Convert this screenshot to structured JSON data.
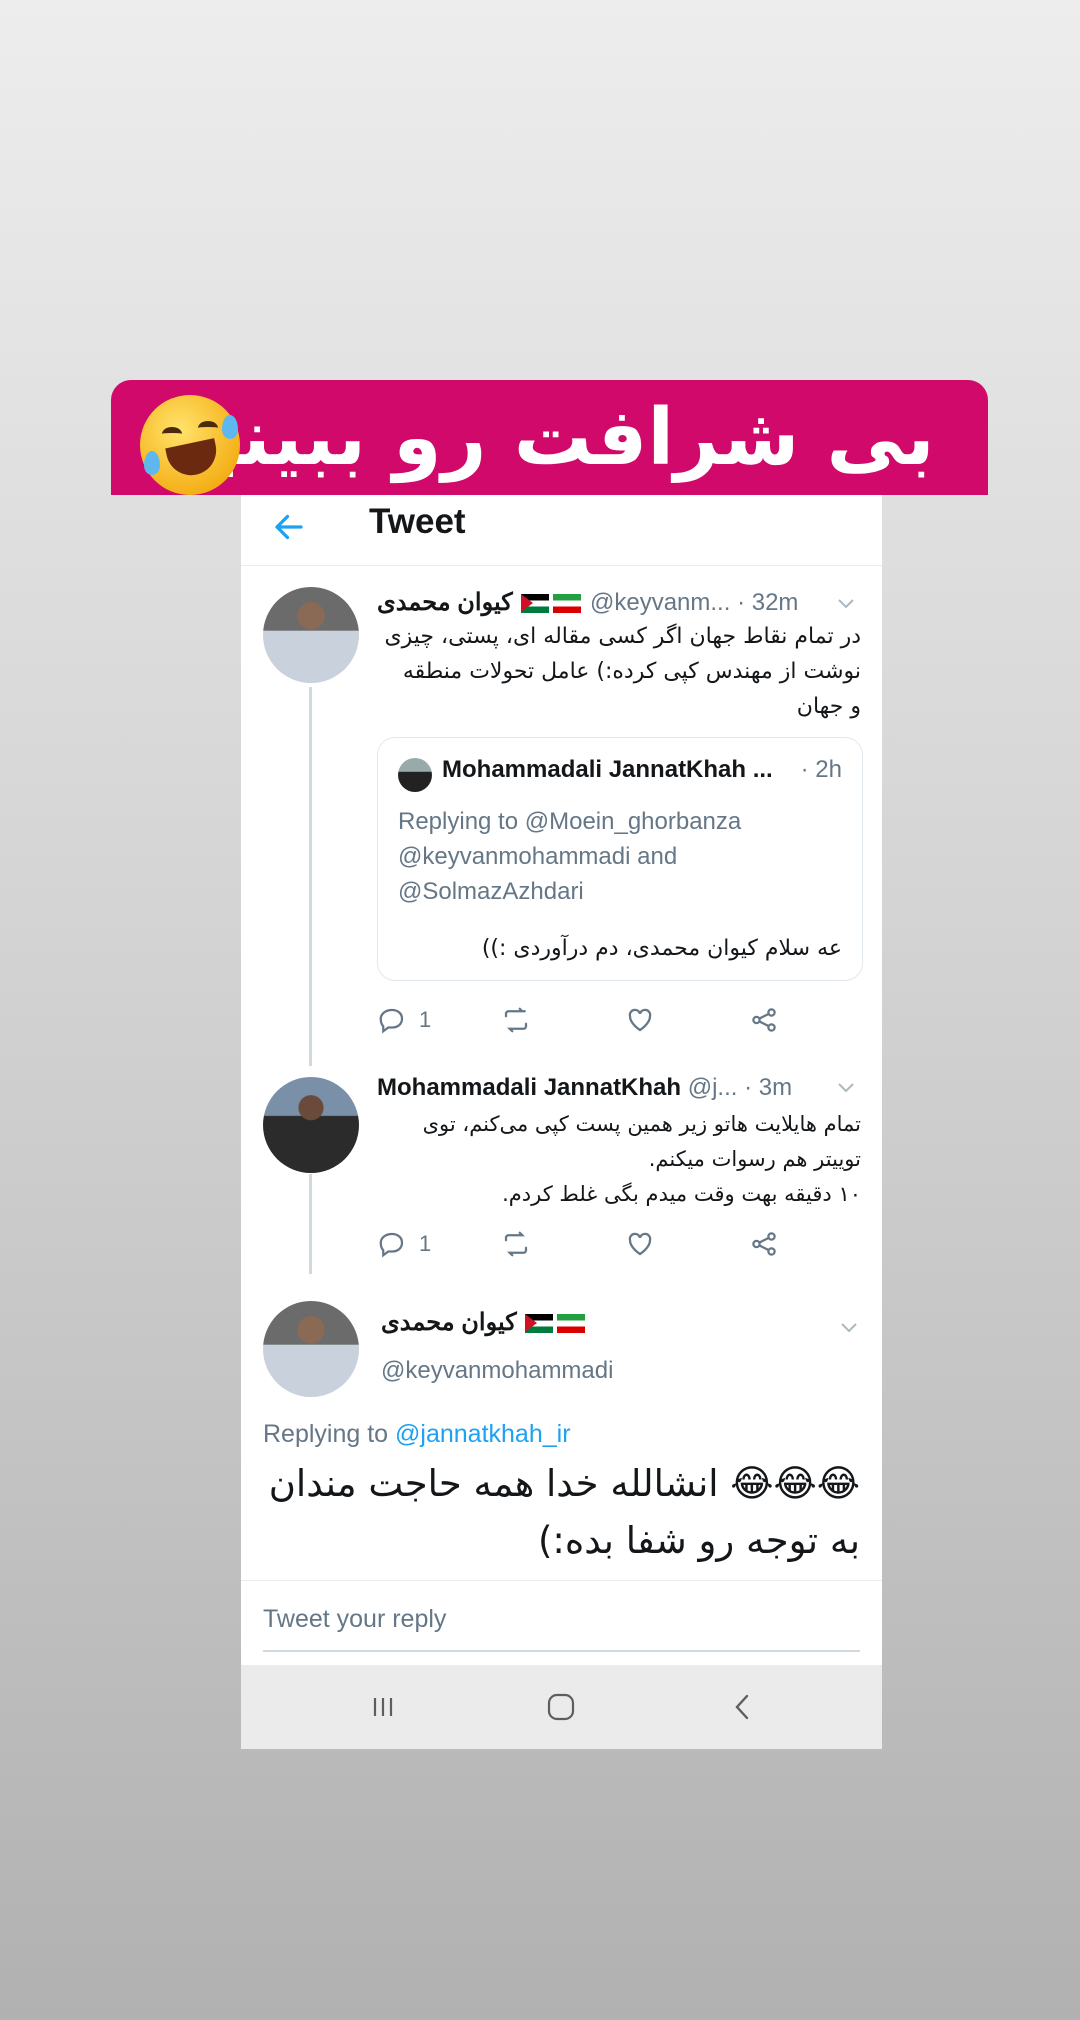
{
  "banner": {
    "text": "بی شرافت رو ببینید",
    "emoji": "rofl-emoji"
  },
  "topbar": {
    "title": "Tweet",
    "back_icon": "back-arrow-icon"
  },
  "tweet1": {
    "name": "کیوان محمدی",
    "handle": "@keyvanm...",
    "time": "· 32m",
    "text_line1": "در تمام نقاط جهان اگر کسی مقاله ای، پستی، چیزی",
    "text_line2": "نوشت از مهندس کپی کرده:) عامل تحولات منطقه",
    "text_line3": "و جهان",
    "quote": {
      "name": "Mohammadali JannatKhah ...",
      "time": "· 2h",
      "replying_line1": "Replying to @Moein_ghorbanza",
      "replying_line2": "@keyvanmohammadi and",
      "replying_line3": "@SolmazAzhdari",
      "text": "عه سلام کیوان محمدی، دم درآوردی :))"
    },
    "reply_count": "1"
  },
  "tweet2": {
    "name": "Mohammadali JannatKhah",
    "handle": "@j...",
    "time": "· 3m",
    "text_line1": "تمام هایلایت هاتو زیر همین پست کپی می‌کنم، توی",
    "text_line2": "توییتر هم رسوات میکنم.",
    "text_line3": "۱۰ دقیقه بهت وقت میدم بگی غلط کردم.",
    "reply_count": "1"
  },
  "main_tweet": {
    "name": "کیوان محمدی",
    "handle": "@keyvanmohammadi",
    "replying_prefix": "Replying to",
    "replying_handle": "@jannatkhah_ir",
    "text_line1": "😂😂😂 انشالله خدا همه حاجت مندان",
    "text_line2": "به توجه رو شفا بده:)"
  },
  "reply_box": {
    "placeholder": "Tweet your reply"
  },
  "colors": {
    "banner": "#d0096a",
    "link": "#1da1f2",
    "secondary": "#657786"
  }
}
